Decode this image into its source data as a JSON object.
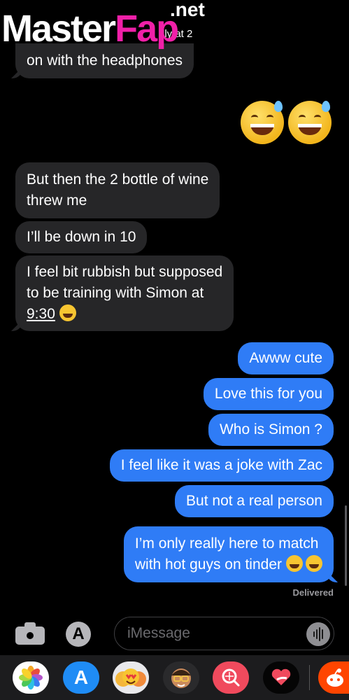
{
  "watermark": {
    "main": "Master",
    "accent": "Fap",
    "suffix": ".net"
  },
  "header": {
    "contact_fragment": "lly at 2"
  },
  "messages": [
    {
      "dir": "in",
      "text": "on with the headphones"
    },
    {
      "dir": "in",
      "lines": [
        "But then the 2 bottle of wine",
        "threw me"
      ]
    },
    {
      "dir": "in",
      "text": "I’ll be down in 10"
    },
    {
      "dir": "in",
      "lines": [
        "I feel bit rubbish but supposed",
        "to be training with Simon at"
      ],
      "time": "9:30"
    },
    {
      "dir": "out",
      "text": "Awww cute"
    },
    {
      "dir": "out",
      "text": "Love this for you"
    },
    {
      "dir": "out",
      "text": "Who is Simon ?"
    },
    {
      "dir": "out",
      "text": "I feel like it was a joke with Zac"
    },
    {
      "dir": "out",
      "text": "But not a real person"
    },
    {
      "dir": "out",
      "lines": [
        "I’m only really here to match",
        "with hot guys on tinder"
      ]
    }
  ],
  "emoji_names": [
    "grinning-sweat-emoji",
    "grinning-sweat-emoji"
  ],
  "status": {
    "delivered": "Delivered"
  },
  "composer": {
    "placeholder": "iMessage",
    "app_store_icon": "A"
  },
  "app_drawer": [
    {
      "name": "photos-app-icon",
      "color": "#ffffff"
    },
    {
      "name": "app-store-app-icon",
      "color": "#1f8cf5"
    },
    {
      "name": "memoji-app-icon",
      "color": "#e9e9ec"
    },
    {
      "name": "memoji-sticker-app-icon",
      "color": "#2a2a2c"
    },
    {
      "name": "search-images-app-icon",
      "color": "#f04a5d"
    },
    {
      "name": "digital-touch-app-icon",
      "color": "#050505"
    },
    {
      "name": "reddit-app-icon",
      "color": "#ff4500"
    }
  ]
}
